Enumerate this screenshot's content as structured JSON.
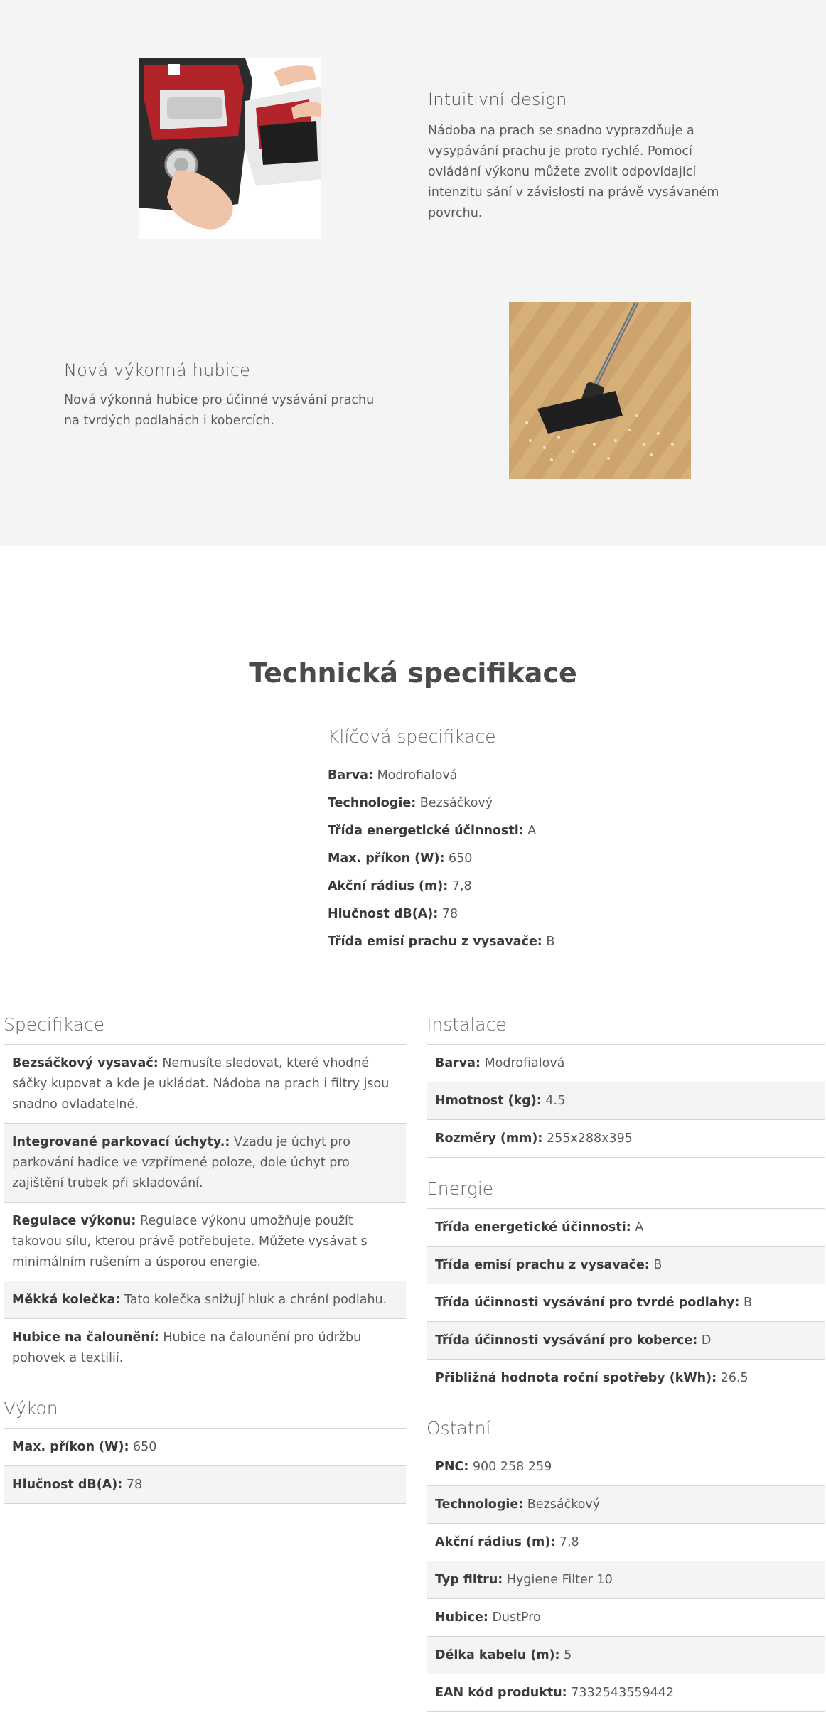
{
  "features": [
    {
      "title": "Intuitivní design",
      "description": "Nádoba na prach se snadno vyprazdňuje a vysypávání prachu je proto rychlé. Pomocí ovládání výkonu můžete zvolit odpovídající intenzitu sání v závislosti na právě vysávaném povrchu.",
      "image": "vacuum-hands-image"
    },
    {
      "title": "Nová výkonná hubice",
      "description": "Nová výkonná hubice pro účinné vysávání prachu na tvrdých podlahách i kobercích.",
      "image": "floor-nozzle-image"
    }
  ],
  "tech": {
    "heading": "Technická specifikace",
    "key_title": "Klíčová specifikace",
    "key": [
      {
        "label": "Barva:",
        "value": "Modrofialová"
      },
      {
        "label": "Technologie:",
        "value": "Bezsáčkový"
      },
      {
        "label": "Třída energetické účinnosti:",
        "value": "A"
      },
      {
        "label": "Max. příkon (W):",
        "value": "650"
      },
      {
        "label": "Akční rádius (m):",
        "value": "7,8"
      },
      {
        "label": "Hlučnost dB(A):",
        "value": "78"
      },
      {
        "label": "Třída emisí prachu z vysavače:",
        "value": "B"
      }
    ]
  },
  "left_sections": [
    {
      "title": "Specifikace",
      "rows": [
        {
          "label": "Bezsáčkový vysavač:",
          "value": "Nemusíte sledovat, které vhodné sáčky kupovat a kde je ukládat. Nádoba na prach i filtry jsou snadno ovladatelné."
        },
        {
          "label": "Integrované parkovací úchyty.:",
          "value": "Vzadu je úchyt pro parkování hadice ve vzpřímené poloze, dole úchyt pro zajištění trubek při skladování."
        },
        {
          "label": "Regulace výkonu:",
          "value": "Regulace výkonu umožňuje použít takovou sílu, kterou právě potřebujete. Můžete vysávat s minimálním rušením a úsporou energie."
        },
        {
          "label": "Měkká kolečka:",
          "value": "Tato kolečka snižují hluk a chrání podlahu."
        },
        {
          "label": "Hubice na čalounění:",
          "value": "Hubice na čalounění pro údržbu pohovek a textilií."
        }
      ]
    },
    {
      "title": "Výkon",
      "rows": [
        {
          "label": "Max. příkon (W):",
          "value": "650"
        },
        {
          "label": "Hlučnost dB(A):",
          "value": "78"
        }
      ]
    }
  ],
  "right_sections": [
    {
      "title": "Instalace",
      "rows": [
        {
          "label": "Barva:",
          "value": "Modrofialová"
        },
        {
          "label": "Hmotnost (kg):",
          "value": "4.5"
        },
        {
          "label": "Rozměry (mm):",
          "value": "255x288x395"
        }
      ]
    },
    {
      "title": "Energie",
      "rows": [
        {
          "label": "Třída energetické účinnosti:",
          "value": "A"
        },
        {
          "label": "Třída emisí prachu z vysavače:",
          "value": "B"
        },
        {
          "label": "Třída účinnosti vysávání pro tvrdé podlahy:",
          "value": "B"
        },
        {
          "label": "Třída účinnosti vysávání pro koberce:",
          "value": "D"
        },
        {
          "label": "Přibližná hodnota roční spotřeby (kWh):",
          "value": "26.5"
        }
      ]
    },
    {
      "title": "Ostatní",
      "rows": [
        {
          "label": "PNC:",
          "value": "900 258 259"
        },
        {
          "label": "Technologie:",
          "value": "Bezsáčkový"
        },
        {
          "label": "Akční rádius (m):",
          "value": "7,8"
        },
        {
          "label": "Typ filtru:",
          "value": "Hygiene Filter 10"
        },
        {
          "label": "Hubice:",
          "value": "DustPro"
        },
        {
          "label": "Délka kabelu (m):",
          "value": "5"
        },
        {
          "label": "EAN kód produktu:",
          "value": "7332543559442"
        }
      ]
    }
  ],
  "colors": {
    "band_background": "#f4f4f4",
    "alt_row": "#f4f4f4",
    "border": "#d5d5d5",
    "text": "#5a5a5a",
    "vacuum_red": "#b3242a"
  }
}
